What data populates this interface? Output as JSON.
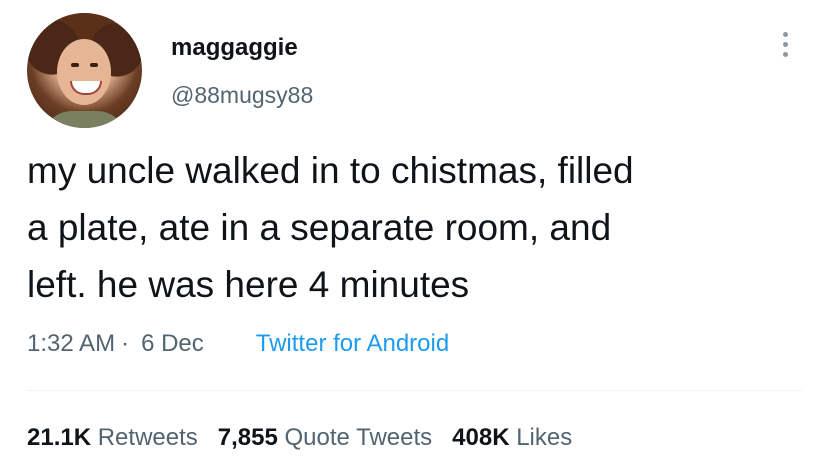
{
  "author": {
    "display_name": "maggaggie",
    "handle": "@88mugsy88",
    "avatar": "profile-photo"
  },
  "tweet": {
    "text_lines": [
      "my uncle walked in to chistmas, filled",
      "a plate, ate in a separate room, and",
      "left. he was here 4 minutes"
    ],
    "time": "1:32 AM",
    "separator": "·",
    "date": "6 Dec",
    "source": "Twitter for Android"
  },
  "stats": {
    "retweets_count": "21.1K",
    "retweets_label": "Retweets",
    "quotes_count": "7,855",
    "quotes_label": "Quote Tweets",
    "likes_count": "408K",
    "likes_label": "Likes"
  },
  "icons": {
    "more": "more-vertical-icon"
  },
  "colors": {
    "text_primary": "#0f1419",
    "text_secondary": "#536471",
    "link": "#1d9bf0",
    "divider": "#eff3f4"
  }
}
